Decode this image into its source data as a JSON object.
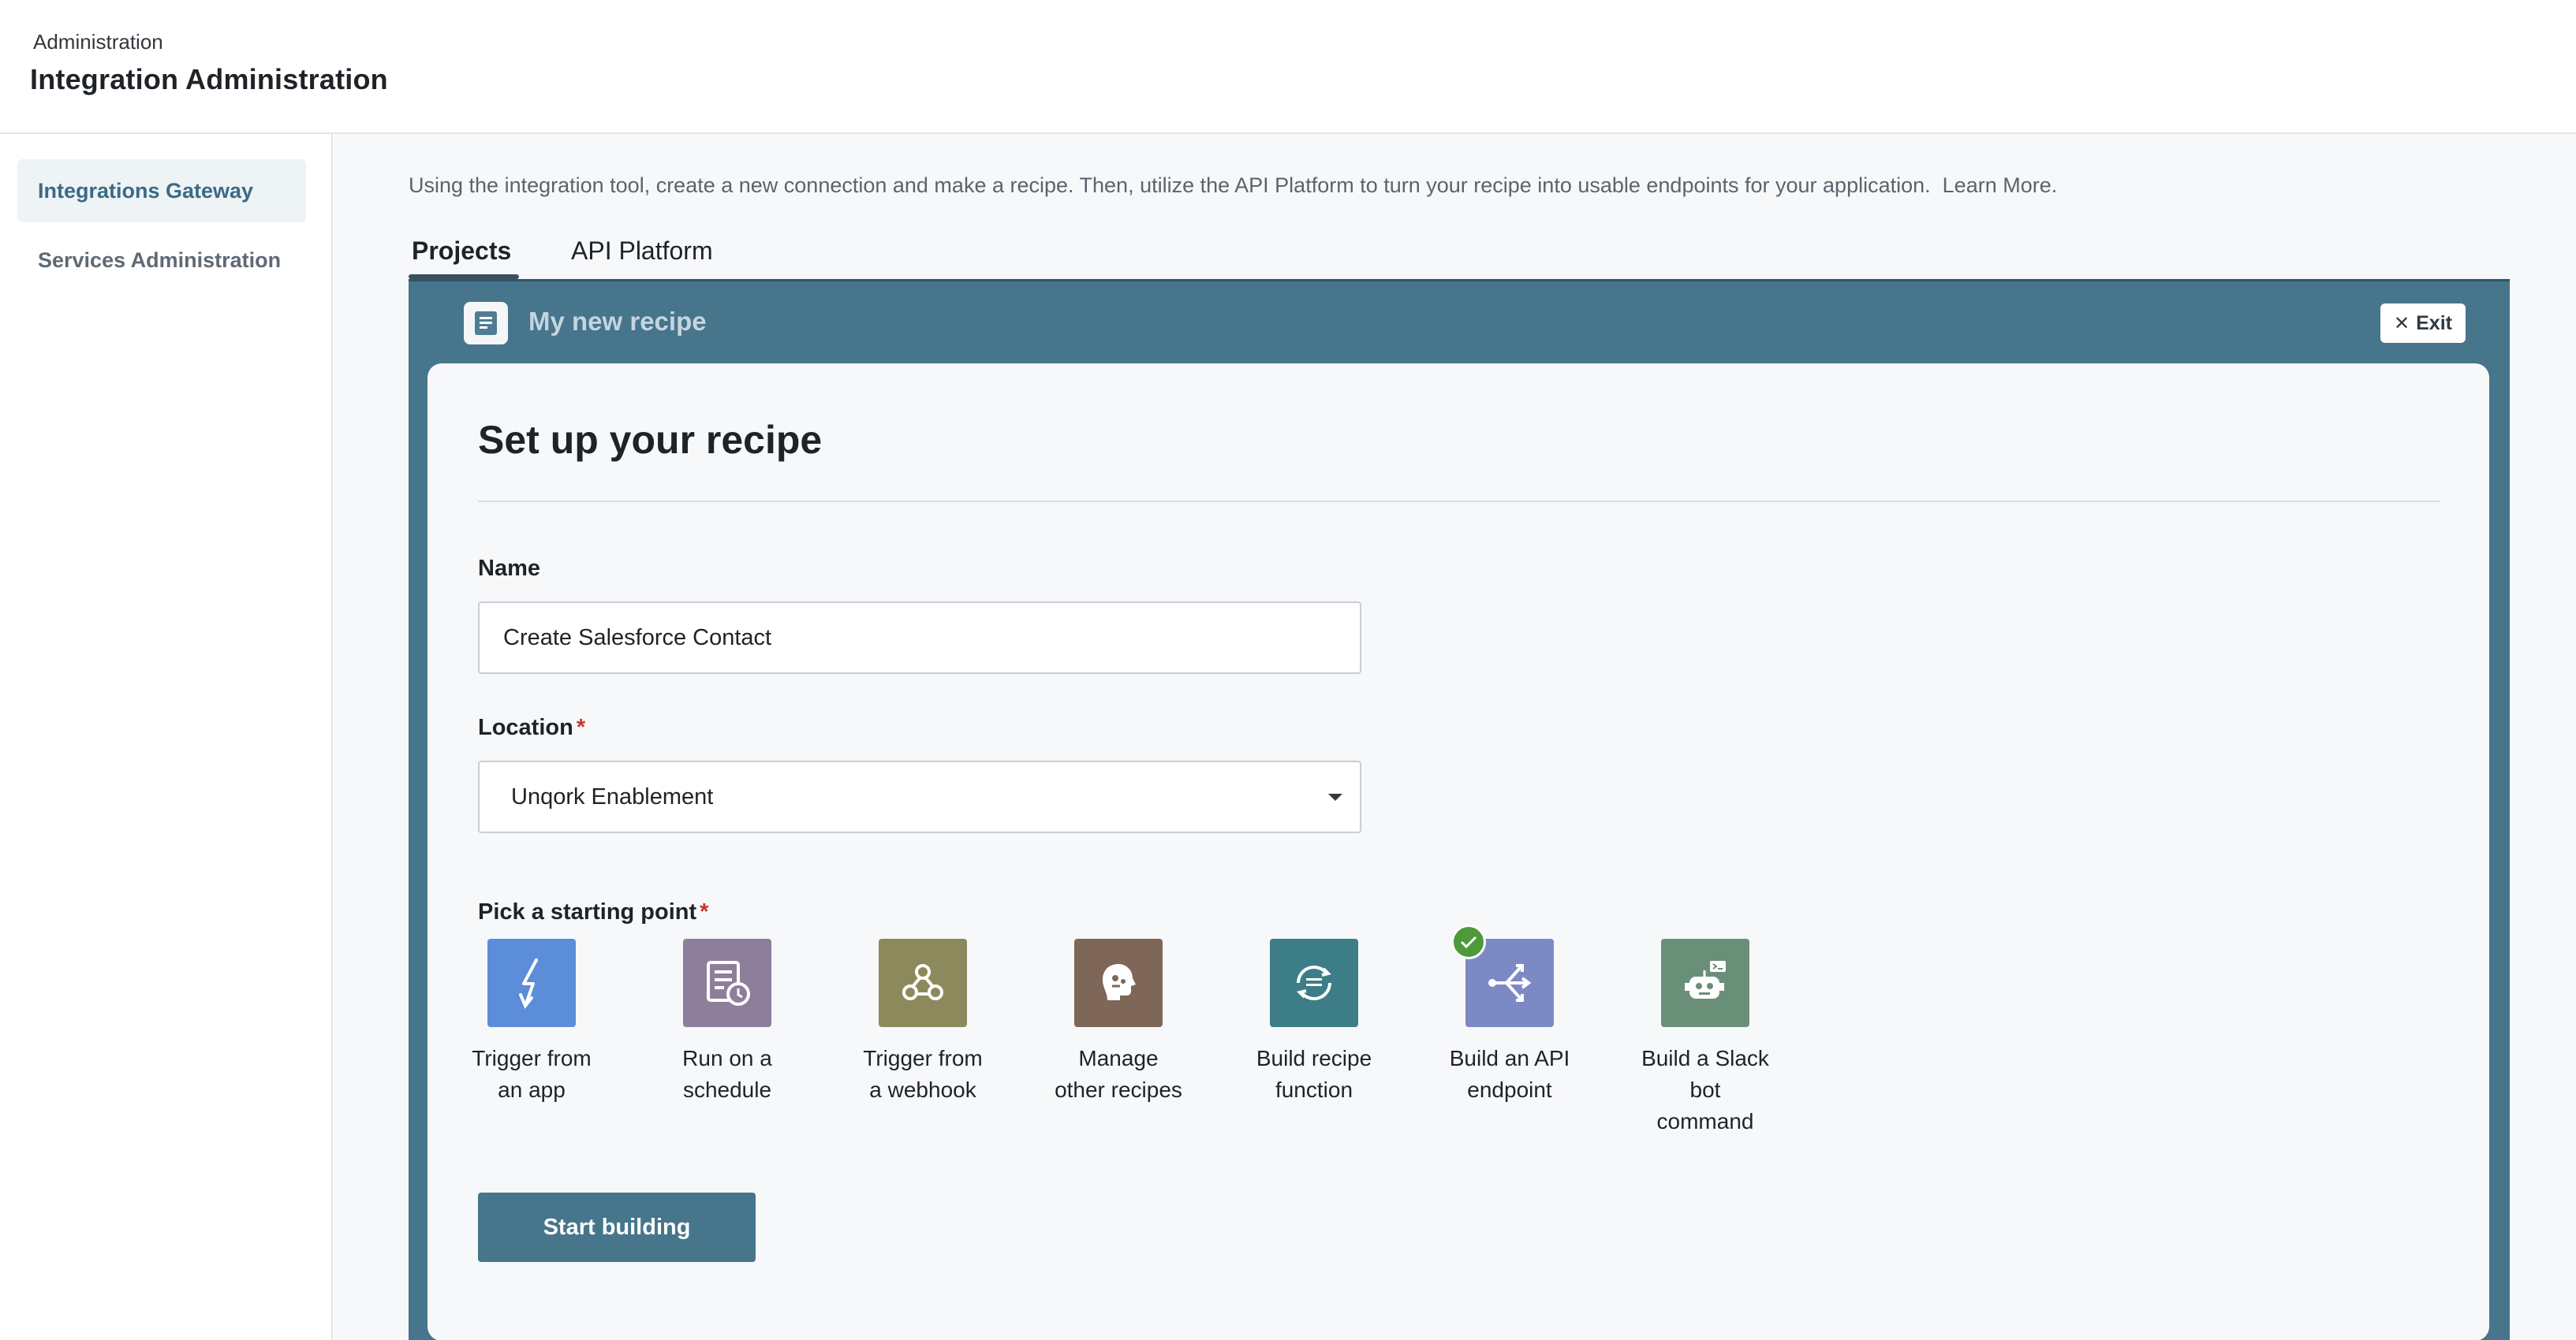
{
  "header": {
    "breadcrumb": "Administration",
    "title": "Integration Administration"
  },
  "sidebar": {
    "items": [
      {
        "label": "Integrations Gateway",
        "active": true
      },
      {
        "label": "Services Administration",
        "active": false
      }
    ]
  },
  "main": {
    "intro_text": "Using the integration tool, create a new connection and make a recipe. Then, utilize the API Platform to turn your recipe into usable endpoints for your application.",
    "learn_more": "Learn More.",
    "tabs": [
      {
        "label": "Projects",
        "selected": true
      },
      {
        "label": "API Platform",
        "selected": false
      }
    ]
  },
  "recipe": {
    "header_title": "My new recipe",
    "header_icon": "document-icon",
    "exit_label": "Exit",
    "card_title": "Set up your recipe",
    "name_label": "Name",
    "name_value": "Create Salesforce Contact",
    "location_label": "Location",
    "location_required_mark": "*",
    "location_value": "Unqork Enablement",
    "starting_point_label": "Pick a starting point",
    "starting_point_required_mark": "*",
    "starting_points": [
      {
        "line1": "Trigger from",
        "line2": "an app",
        "line3": "",
        "icon": "lightning-icon",
        "color": "#5b8dd9",
        "selected": false
      },
      {
        "line1": "Run on a",
        "line2": "schedule",
        "line3": "",
        "icon": "schedule-icon",
        "color": "#8d7f9a",
        "selected": false
      },
      {
        "line1": "Trigger from",
        "line2": "a webhook",
        "line3": "",
        "icon": "webhook-icon",
        "color": "#8c8a5c",
        "selected": false
      },
      {
        "line1": "Manage",
        "line2": "other recipes",
        "line3": "",
        "icon": "brain-icon",
        "color": "#7e6658",
        "selected": false
      },
      {
        "line1": "Build recipe",
        "line2": "function",
        "line3": "",
        "icon": "function-icon",
        "color": "#3d7d88",
        "selected": false
      },
      {
        "line1": "Build an API",
        "line2": "endpoint",
        "line3": "",
        "icon": "api-endpoint-icon",
        "color": "#7d89c4",
        "selected": true
      },
      {
        "line1": "Build a Slack",
        "line2": "bot",
        "line3": "command",
        "icon": "slack-bot-icon",
        "color": "#6a8f78",
        "selected": false
      }
    ],
    "start_button": "Start building"
  }
}
